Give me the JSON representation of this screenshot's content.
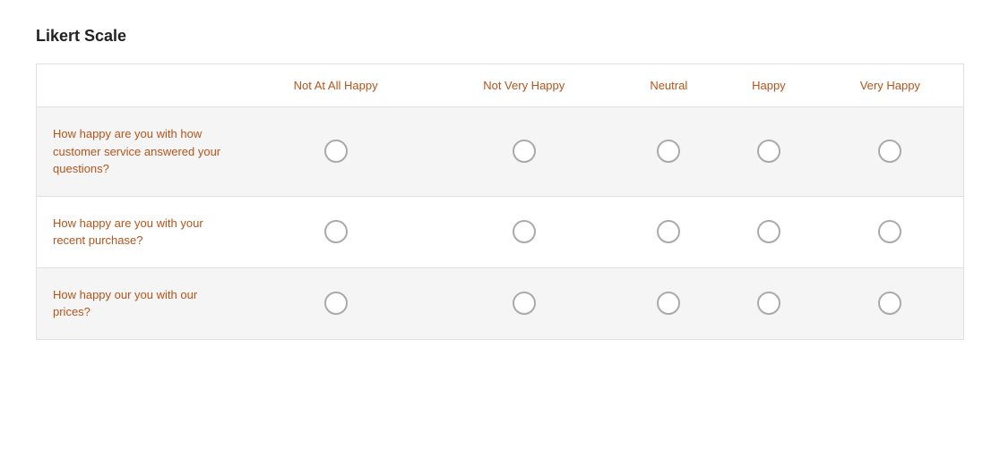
{
  "title": "Likert Scale",
  "columns": [
    {
      "id": "label",
      "text": ""
    },
    {
      "id": "col1",
      "text": "Not At All Happy"
    },
    {
      "id": "col2",
      "text": "Not Very Happy"
    },
    {
      "id": "col3",
      "text": "Neutral"
    },
    {
      "id": "col4",
      "text": "Happy"
    },
    {
      "id": "col5",
      "text": "Very Happy"
    }
  ],
  "rows": [
    {
      "id": "row1",
      "question": "How happy are you with how customer service answered your questions?"
    },
    {
      "id": "row2",
      "question": "How happy are you with your recent purchase?"
    },
    {
      "id": "row3",
      "question": "How happy our you with our prices?"
    }
  ]
}
